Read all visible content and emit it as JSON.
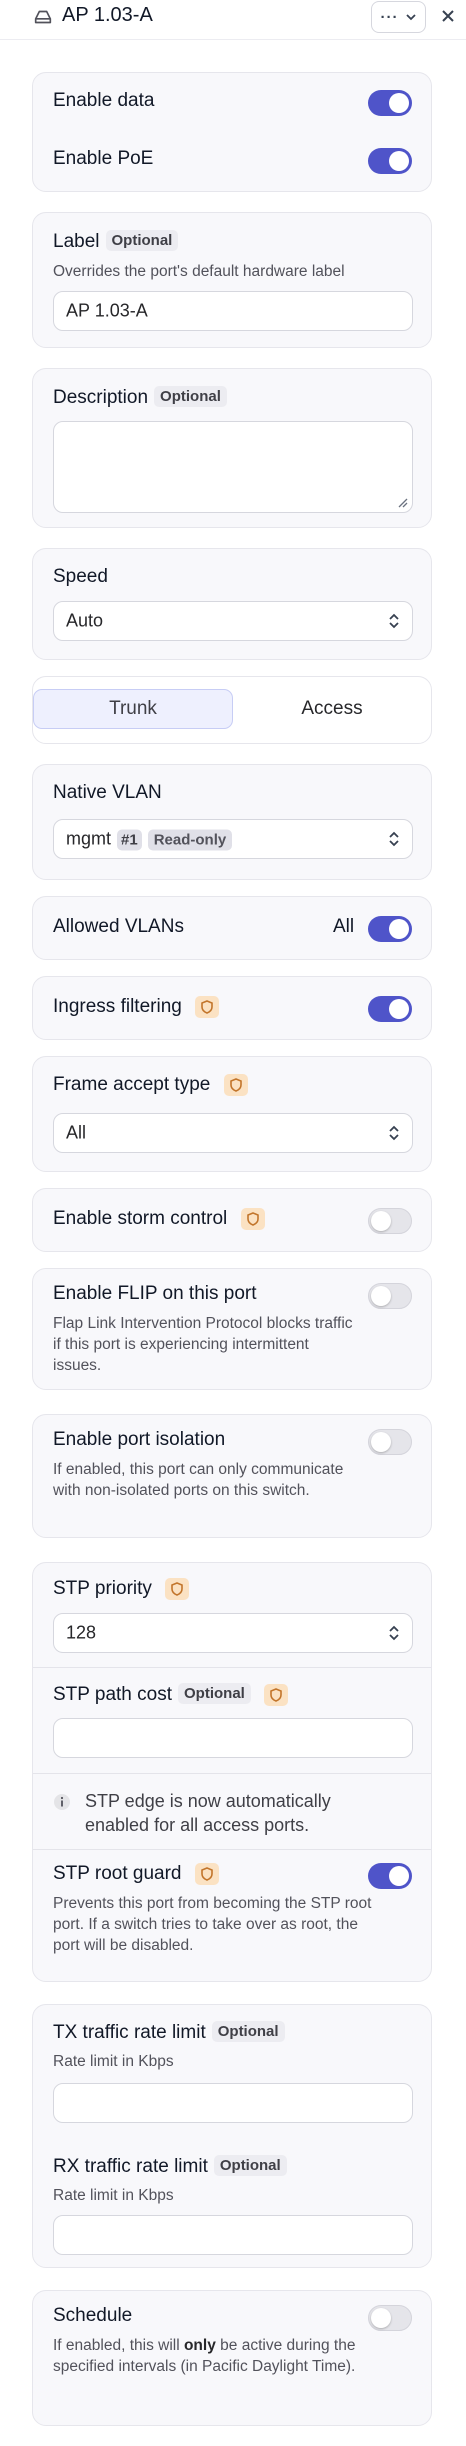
{
  "header": {
    "title": "AP 1.03-A",
    "more_label": "···"
  },
  "enable": {
    "data_label": "Enable data",
    "poe_label": "Enable PoE"
  },
  "label_field": {
    "title": "Label",
    "badge": "Optional",
    "help": "Overrides the port's default hardware label",
    "value": "AP 1.03-A"
  },
  "description_field": {
    "title": "Description",
    "badge": "Optional",
    "value": ""
  },
  "speed": {
    "title": "Speed",
    "value": "Auto"
  },
  "mode_tabs": {
    "trunk": "Trunk",
    "access": "Access",
    "selected": "Trunk"
  },
  "native_vlan": {
    "title": "Native VLAN",
    "name": "mgmt",
    "id": "#1",
    "tag": "Read-only"
  },
  "allowed_vlans": {
    "title": "Allowed VLANs",
    "value": "All"
  },
  "ingress": {
    "title": "Ingress filtering"
  },
  "frame_accept": {
    "title": "Frame accept type",
    "value": "All"
  },
  "storm": {
    "title": "Enable storm control"
  },
  "flip": {
    "title": "Enable FLIP on this port",
    "help": "Flap Link Intervention Protocol blocks traffic if this port is experiencing intermittent issues."
  },
  "isolation": {
    "title": "Enable port isolation",
    "help": "If enabled, this port can only communicate with non-isolated ports on this switch."
  },
  "stp": {
    "priority_title": "STP priority",
    "priority_value": "128",
    "path_cost_title": "STP path cost",
    "path_cost_badge": "Optional",
    "path_cost_value": "",
    "edge_note": "STP edge is now automatically enabled for all access ports.",
    "root_guard_title": "STP root guard",
    "root_guard_help": "Prevents this port from becoming the STP root port. If a switch tries to take over as root, the port will be disabled."
  },
  "rate_limits": {
    "tx_title": "TX traffic rate limit",
    "tx_badge": "Optional",
    "tx_help": "Rate limit in Kbps",
    "tx_value": "",
    "rx_title": "RX traffic rate limit",
    "rx_badge": "Optional",
    "rx_help": "Rate limit in Kbps",
    "rx_value": ""
  },
  "schedule": {
    "title": "Schedule",
    "help_before": "If enabled, this will ",
    "help_bold": "only",
    "help_after": " be active during the specified intervals (in Pacific Daylight Time)."
  },
  "toggles": {
    "enable_data": true,
    "enable_poe": true,
    "allowed_vlans_all": true,
    "ingress_filtering": true,
    "storm_control": false,
    "flip": false,
    "port_isolation": false,
    "stp_root_guard": true,
    "schedule": false
  },
  "colors": {
    "accent": "#4f54c9",
    "shield_bg": "#fbe2c3",
    "shield_fg": "#c2752b",
    "card_bg": "#f8f8fb"
  },
  "icons": [
    "access-point-icon",
    "more-icon",
    "chevron-down-icon",
    "close-icon",
    "shield-icon",
    "updown-chevron-icon",
    "info-icon",
    "resize-handle-icon"
  ]
}
